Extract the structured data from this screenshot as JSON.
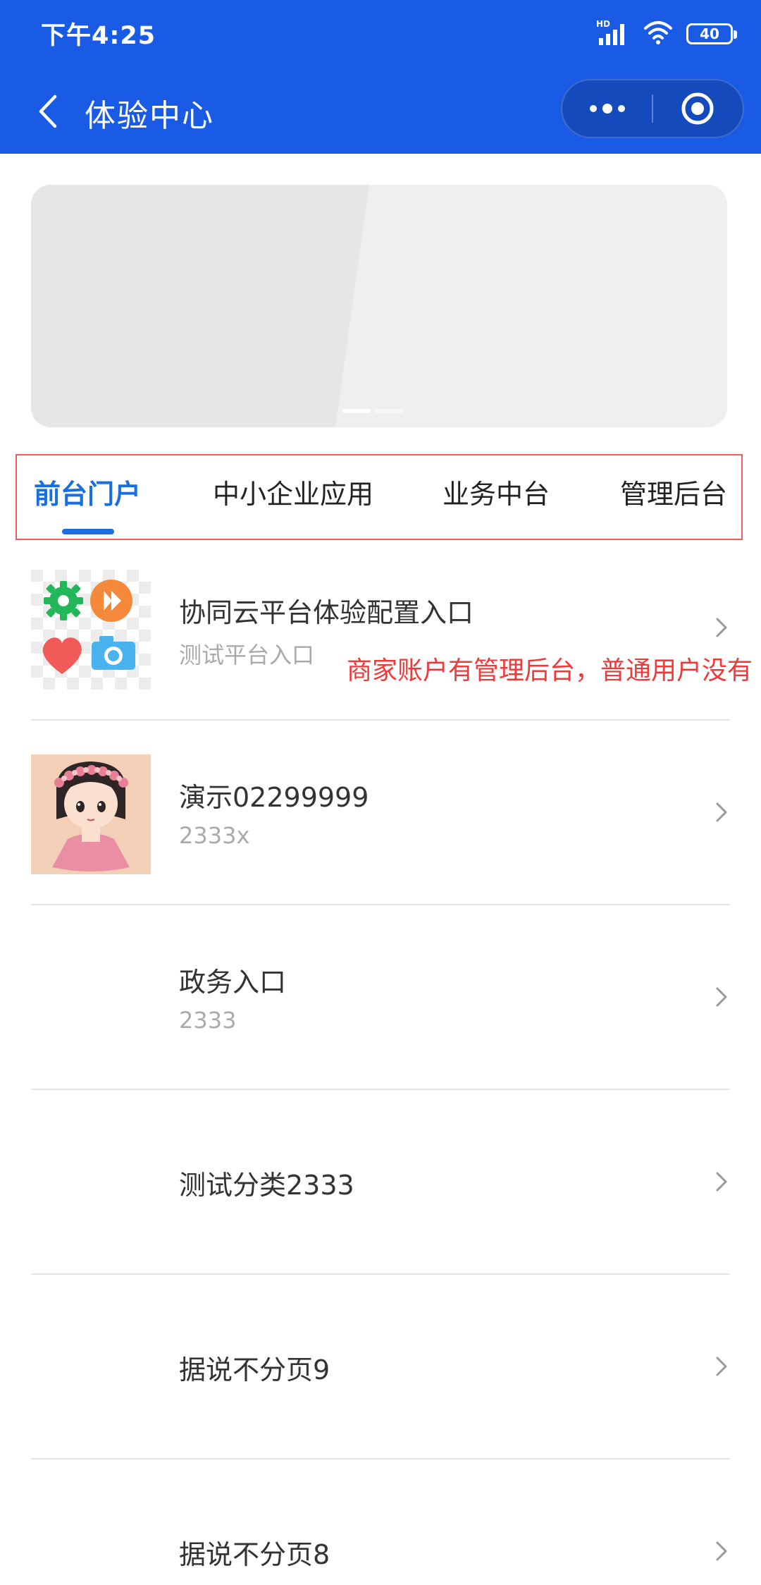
{
  "status_bar": {
    "time": "下午4:25",
    "battery": "40",
    "network_label": "HD"
  },
  "nav": {
    "title": "体验中心"
  },
  "tabs": [
    {
      "label": "前台门户"
    },
    {
      "label": "中小企业应用"
    },
    {
      "label": "业务中台"
    },
    {
      "label": "管理后台"
    }
  ],
  "annotation": {
    "text": "商家账户有管理后台，普通用户没有"
  },
  "list": [
    {
      "title": "协同云平台体验配置入口",
      "subtitle": "测试平台入口"
    },
    {
      "title": "演示02299999",
      "subtitle": "2333x"
    },
    {
      "title": "政务入口",
      "subtitle": "2333"
    },
    {
      "title": "测试分类2333"
    },
    {
      "title": "据说不分页9"
    },
    {
      "title": "据说不分页8"
    }
  ],
  "colors": {
    "header_blue": "#1a5be6",
    "tab_active": "#1a6fe0",
    "annotation_red": "#f03a3a",
    "subtitle_gray": "#aaaaaa"
  }
}
